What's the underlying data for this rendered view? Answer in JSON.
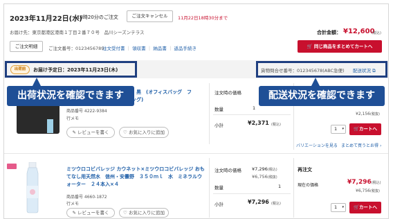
{
  "order": {
    "date": "2023年11月22日(水)",
    "time": "18時20分のご注文",
    "cancel_button": "ご注文キャンセル",
    "cancel_deadline": "11月22日18時30分まで",
    "address_label": "お届け先：東京都港区港南１丁目２番７０号　品川シーズンテラス",
    "total_label": "合計金額：",
    "total_value": "¥12,600",
    "tax_note": "(税込)",
    "detail_button": "ご注文明細",
    "order_number": "ご注文番号：0123456789",
    "links": [
      "注文受付書",
      "領収書",
      "納品書",
      "返品手続き"
    ],
    "cart_all_button": "同じ商品をまとめてカートへ"
  },
  "shipping": {
    "status_badge": "出荷前",
    "scheduled_label": "お届け予定日：2023年11月23日(木)",
    "tracking_label": "貨物問合せ番号：012345678(ABC急便)",
    "tracking_link": "配送状況"
  },
  "callouts": {
    "left": "出荷状況を確認できます",
    "right": "配送状況を確認できます"
  },
  "items": [
    {
      "name_line1": "ブ　黒　(オフィスバッグ　フ",
      "name_line2": "バッグ)",
      "product_number": "商品番号 4222-9384",
      "memo": "行メモ",
      "review_button": "レビューを書く",
      "fav_button": "お気に入りに追加",
      "price_at_order_label": "注文時の価格",
      "price_at_order": "¥2,371",
      "price_unit": "",
      "qty_label": "数量",
      "qty_value": "1",
      "subtotal_label": "小計",
      "subtotal": "¥2,371",
      "subtotal_tax": "(税込)",
      "right_price_old": "¥2,156",
      "right_price_old_tax": "(税抜)",
      "qty_select": "1",
      "cart_button": "カートへ",
      "variation_link": "バリエーションを見る",
      "bulk_link": "まとめて買うとお得"
    },
    {
      "name": "ミツウロコビバレッジ カウネット×ミツウロコビバレッジ おもてなし用天然水　信州・安曇野　３５０ｍｌ　水　ミネラルウォーター　２４本入×４",
      "product_number": "商品番号 4660-1872",
      "memo": "行メモ",
      "review_button": "レビューを書く",
      "fav_button": "お気に入りに追加",
      "price_at_order_label": "注文時の価格",
      "price_at_order": "¥7,296",
      "price_at_order_tax": "(税込)",
      "price_at_order_ex": "¥6,756",
      "price_at_order_ex_tax": "(税抜)",
      "qty_label": "数量",
      "qty_value": "1",
      "subtotal_label": "小計",
      "subtotal": "¥7,296",
      "subtotal_tax": "(税込)",
      "reorder_label": "再注文",
      "current_price_label": "現在の価格",
      "current_price": "¥7,296",
      "current_price_tax": "(税込)",
      "current_price_ex": "¥6,756",
      "current_price_ex_tax": "(税抜)",
      "qty_select": "1",
      "cart_button": "カートへ"
    }
  ]
}
